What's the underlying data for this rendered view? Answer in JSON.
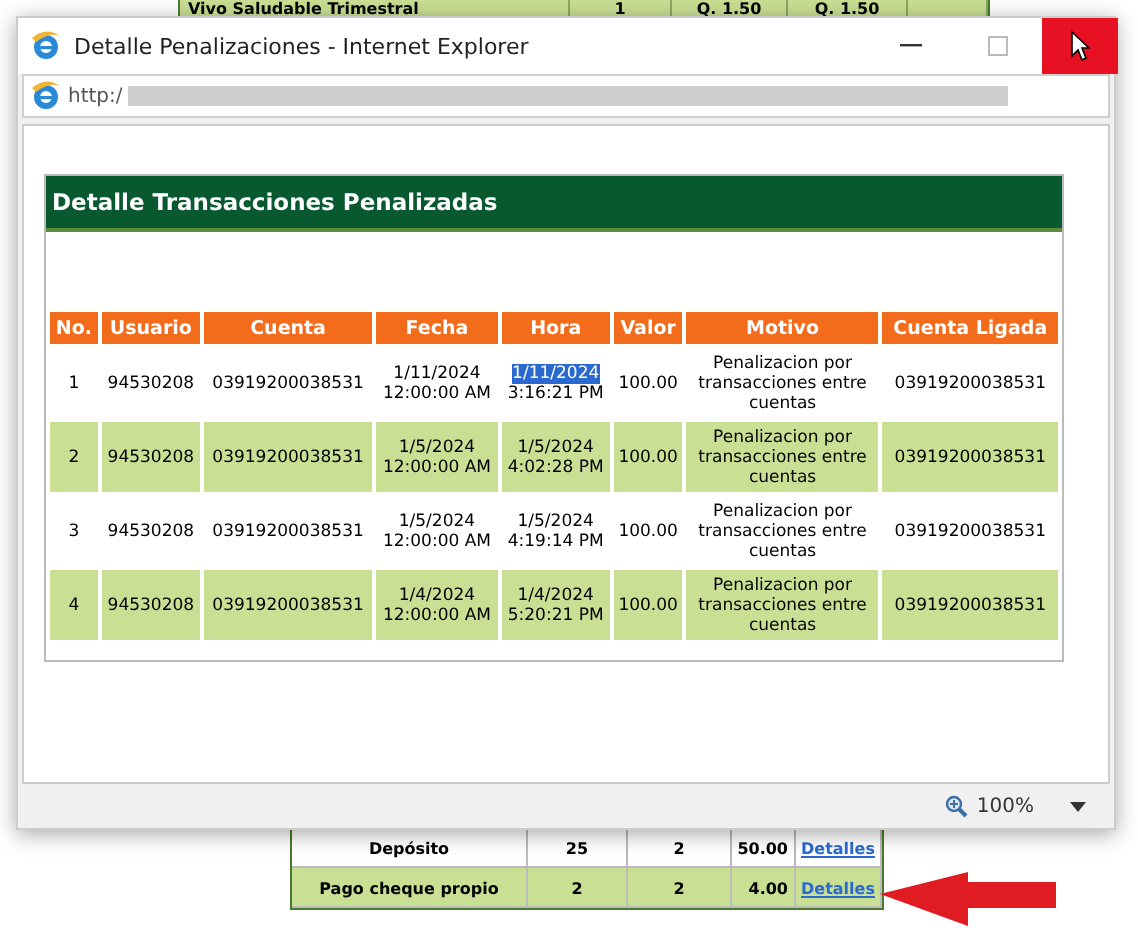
{
  "background_page": {
    "top_row": [
      "Vivo Saludable Trimestral",
      "1",
      "Q. 1.50",
      "Q. 1.50"
    ],
    "bottom_rows": [
      {
        "concepto": "Depósito",
        "col_2": "25",
        "col_3": "2",
        "monto": "50.00",
        "link": "Detalles"
      },
      {
        "concepto": "Pago cheque propio",
        "col_2": "2",
        "col_3": "2",
        "monto": "4.00",
        "link": "Detalles"
      }
    ]
  },
  "window": {
    "title": "Detalle Penalizaciones - Internet Explorer",
    "address": "http:/",
    "zoom": "100%"
  },
  "panel": {
    "title": "Detalle Transacciones Penalizadas",
    "columns": [
      "No.",
      "Usuario",
      "Cuenta",
      "Fecha",
      "Hora",
      "Valor",
      "Motivo",
      "Cuenta Ligada"
    ],
    "rows": [
      {
        "no": "1",
        "usuario": "94530208",
        "cuenta": "03919200038531",
        "fecha": [
          "1/11/2024",
          "12:00:00 AM"
        ],
        "hora": [
          "1/11/2024",
          "3:16:21 PM"
        ],
        "hora_date_selected": true,
        "valor": "100.00",
        "motivo": "Penalizacion por transacciones entre cuentas",
        "cuenta_ligada": "03919200038531"
      },
      {
        "no": "2",
        "usuario": "94530208",
        "cuenta": "03919200038531",
        "fecha": [
          "1/5/2024",
          "12:00:00 AM"
        ],
        "hora": [
          "1/5/2024",
          "4:02:28 PM"
        ],
        "hora_date_selected": false,
        "valor": "100.00",
        "motivo": "Penalizacion por transacciones entre cuentas",
        "cuenta_ligada": "03919200038531"
      },
      {
        "no": "3",
        "usuario": "94530208",
        "cuenta": "03919200038531",
        "fecha": [
          "1/5/2024",
          "12:00:00 AM"
        ],
        "hora": [
          "1/5/2024",
          "4:19:14 PM"
        ],
        "hora_date_selected": false,
        "valor": "100.00",
        "motivo": "Penalizacion por transacciones entre cuentas",
        "cuenta_ligada": "03919200038531"
      },
      {
        "no": "4",
        "usuario": "94530208",
        "cuenta": "03919200038531",
        "fecha": [
          "1/4/2024",
          "12:00:00 AM"
        ],
        "hora": [
          "1/4/2024",
          "5:20:21 PM"
        ],
        "hora_date_selected": false,
        "valor": "100.00",
        "motivo": "Penalizacion por transacciones entre cuentas",
        "cuenta_ligada": "03919200038531"
      }
    ]
  }
}
